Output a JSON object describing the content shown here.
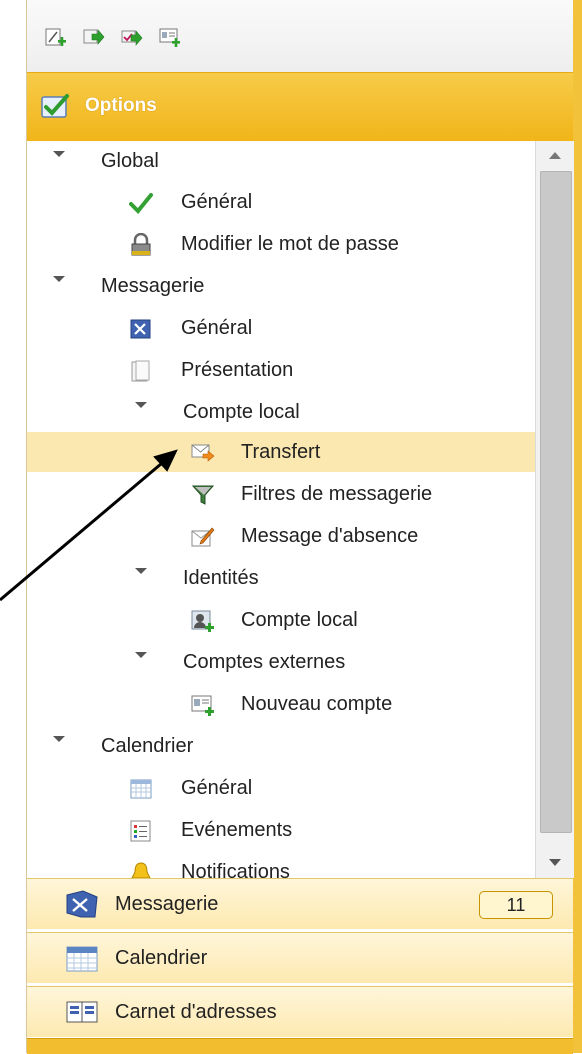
{
  "toolbar": {
    "icons": [
      "new-item-icon",
      "forward-icon",
      "send-receive-icon",
      "contact-card-icon"
    ]
  },
  "options_header": {
    "title": "Options"
  },
  "tree": {
    "items": [
      {
        "label": "Global",
        "type": "group"
      },
      {
        "label": "Général",
        "icon": "checkmark-icon"
      },
      {
        "label": "Modifier le mot de passe",
        "icon": "padlock-icon"
      },
      {
        "label": "Messagerie",
        "type": "group"
      },
      {
        "label": "Général",
        "icon": "mail-settings-icon"
      },
      {
        "label": "Présentation",
        "icon": "layout-icon"
      },
      {
        "label": "Compte local",
        "type": "group"
      },
      {
        "label": "Transfert",
        "icon": "forward-mail-icon",
        "selected": true
      },
      {
        "label": "Filtres de messagerie",
        "icon": "filter-icon"
      },
      {
        "label": "Message d'absence",
        "icon": "absence-message-icon"
      },
      {
        "label": "Identités",
        "type": "group"
      },
      {
        "label": "Compte local",
        "icon": "identity-user-icon"
      },
      {
        "label": "Comptes externes",
        "type": "group"
      },
      {
        "label": "Nouveau compte",
        "icon": "new-account-icon"
      },
      {
        "label": "Calendrier",
        "type": "group"
      },
      {
        "label": "Général",
        "icon": "calendar-grid-icon"
      },
      {
        "label": "Evénements",
        "icon": "events-list-icon"
      },
      {
        "label": "Notifications",
        "icon": "bell-icon"
      }
    ]
  },
  "bottom_nav": {
    "items": [
      {
        "label": "Messagerie",
        "badge": "11",
        "icon": "messaging-icon"
      },
      {
        "label": "Calendrier",
        "icon": "calendar-icon"
      },
      {
        "label": "Carnet d'adresses",
        "icon": "address-book-icon"
      }
    ]
  },
  "colors": {
    "header": "#f3bf2c",
    "selected_row": "#fbe7b0",
    "nav_background": "#fdebb8"
  }
}
